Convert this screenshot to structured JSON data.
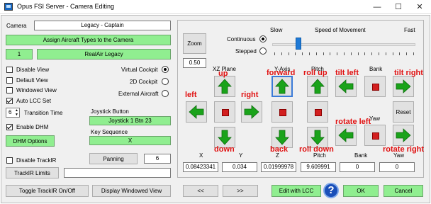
{
  "window": {
    "title": "Opus FSI Server - Camera Editing",
    "minimize": "—",
    "maximize": "☐",
    "close": "✕"
  },
  "left": {
    "camera_label": "Camera",
    "camera_name": "Legacy - Captain",
    "assign_button": "Assign Aircraft Types to the Camera",
    "aircraft_index": "1",
    "aircraft_name": "RealAir Legacy",
    "checkboxes": [
      {
        "label": "Disable View",
        "checked": false
      },
      {
        "label": "Default View",
        "checked": false
      },
      {
        "label": "Windowed View",
        "checked": false
      },
      {
        "label": "Auto LCC Set",
        "checked": true
      }
    ],
    "view_radios": [
      {
        "label": "Virtual Cockpit",
        "selected": true
      },
      {
        "label": "2D Cockpit",
        "selected": false
      },
      {
        "label": "External Aircraft",
        "selected": false
      }
    ],
    "transition_value": "6",
    "transition_label": "Transition Time",
    "joystick_label": "Joystick Button",
    "joystick_value": "Joystick 1 Btn 23",
    "enable_dhm_label": "Enable DHM",
    "enable_dhm_checked": true,
    "key_sequence_label": "Key Sequence",
    "key_sequence_value": "X",
    "dhm_options": "DHM Options",
    "disable_trackir_label": "Disable TrackIR",
    "disable_trackir_checked": false,
    "panning_button": "Panning",
    "panning_value": "6",
    "trackir_limits": "TrackIR Limits",
    "toggle_trackir": "Toggle TrackIR On/Off",
    "display_windowed": "Display Windowed View"
  },
  "right": {
    "zoom_button": "Zoom",
    "zoom_value": "0.50",
    "continuous_label": "Continuous",
    "continuous_selected": true,
    "stepped_label": "Stepped",
    "stepped_selected": false,
    "speed_slow": "Slow",
    "speed_label": "Speed of Movement",
    "speed_fast": "Fast",
    "speed_level": 0.17,
    "headers": {
      "xz_plane": "XZ Plane",
      "y_axis": "Y-Axis",
      "pitch": "Pitch",
      "bank": "Bank",
      "yaw": "Yaw"
    },
    "reset_button": "Reset",
    "coord_labels": {
      "x": "X",
      "y": "Y",
      "z": "Z",
      "pitch": "Pitch",
      "bank": "Bank",
      "yaw": "Yaw"
    },
    "coord_values": {
      "x": "0.08423341",
      "y": "0.034",
      "z": "0.01999978",
      "pitch": "9.609991",
      "bank": "0",
      "yaw": "0"
    }
  },
  "annotations": {
    "up": "up",
    "left": "left",
    "right": "right",
    "down": "down",
    "forward": "forward",
    "back": "back",
    "roll_up": "roll up",
    "roll_down": "roll down",
    "tilt_left": "tilt left",
    "tilt_right": "tilt right",
    "rotate_left": "rotate left",
    "rotate_right": "rotate right"
  },
  "footer": {
    "prev": "<<",
    "next": ">>",
    "edit_lcc": "Edit with LCC",
    "help": "?",
    "ok": "OK",
    "cancel": "Cancel"
  },
  "colors": {
    "arrow_green": "#1aa31a",
    "stop_red": "#d21f1f",
    "annotation_red": "#e01010",
    "green_field": "#90ee90"
  }
}
